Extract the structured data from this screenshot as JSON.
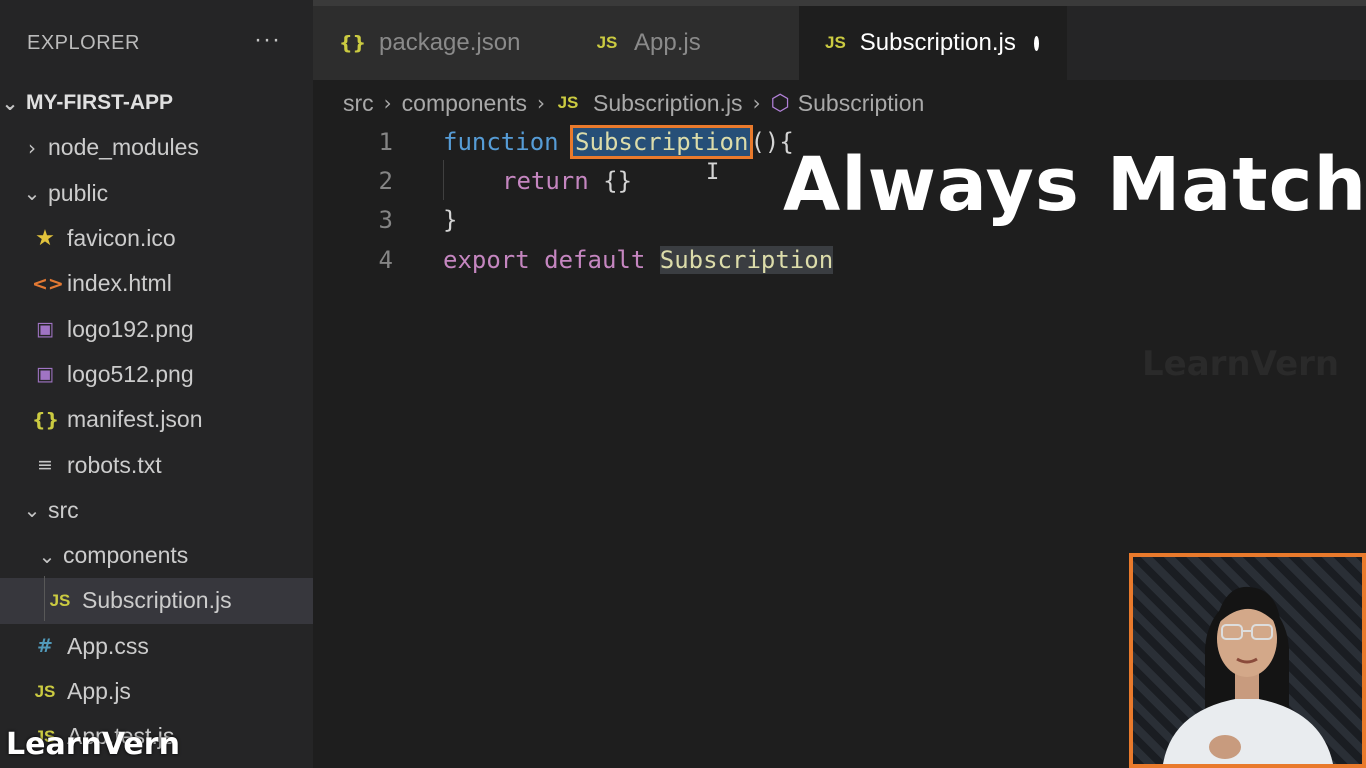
{
  "sidebar": {
    "title": "EXPLORER",
    "more_icon": "···",
    "project": "MY-FIRST-APP",
    "items": [
      {
        "label": "node_modules"
      },
      {
        "label": "public"
      },
      {
        "label": "favicon.ico"
      },
      {
        "label": "index.html"
      },
      {
        "label": "logo192.png"
      },
      {
        "label": "logo512.png"
      },
      {
        "label": "manifest.json"
      },
      {
        "label": "robots.txt"
      },
      {
        "label": "src"
      },
      {
        "label": "components"
      },
      {
        "label": "Subscription.js"
      },
      {
        "label": "App.css"
      },
      {
        "label": "App.js"
      },
      {
        "label": "App.test.js"
      }
    ]
  },
  "tabs": [
    {
      "label": "package.json",
      "icon": "{}"
    },
    {
      "label": "App.js",
      "icon": "JS"
    },
    {
      "label": "Subscription.js",
      "icon": "JS",
      "active": true,
      "dirty": true
    }
  ],
  "breadcrumb": {
    "parts": [
      "src",
      "components",
      "Subscription.js",
      "Subscription"
    ],
    "js_icon": "JS"
  },
  "editor": {
    "line_numbers": [
      "1",
      "2",
      "3",
      "4"
    ],
    "line1": {
      "kw": "function",
      "name": "Subscription",
      "rest": "(){"
    },
    "line2": {
      "kw": "return",
      "rest": " {}"
    },
    "line3": {
      "text": "}"
    },
    "line4": {
      "kw": "export default",
      "name": "Subscription"
    }
  },
  "overlay": {
    "caption": "Always Match",
    "watermark": "LearnVern"
  },
  "colors": {
    "accent_orange": "#e97a2c",
    "keyword_blue": "#569cd6",
    "keyword_purple": "#c586c0",
    "function_yellow": "#dcdcaa"
  }
}
